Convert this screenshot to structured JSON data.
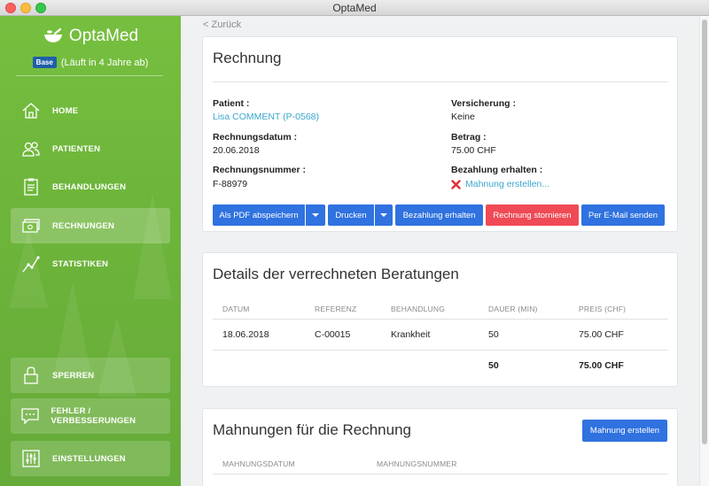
{
  "window": {
    "title": "OptaMed"
  },
  "sidebar": {
    "app_name": "OptaMed",
    "plan_badge": "Base",
    "plan_text": "(Läuft in 4 Jahre ab)",
    "nav": [
      {
        "label": "HOME",
        "icon": "home-icon"
      },
      {
        "label": "PATIENTEN",
        "icon": "patients-icon"
      },
      {
        "label": "BEHANDLUNGEN",
        "icon": "clipboard-icon"
      },
      {
        "label": "RECHNUNGEN",
        "icon": "invoice-icon",
        "active": true
      },
      {
        "label": "STATISTIKEN",
        "icon": "chart-line-icon"
      }
    ],
    "bottom": [
      {
        "label": "SPERREN",
        "icon": "lock-icon"
      },
      {
        "label": "FEHLER / VERBESSERUNGEN",
        "icon": "feedback-icon"
      },
      {
        "label": "EINSTELLUNGEN",
        "icon": "settings-sliders-icon"
      }
    ]
  },
  "back_link": "< Zurück",
  "invoice": {
    "title": "Rechnung",
    "patient_label": "Patient :",
    "patient_value": "Lisa COMMENT (P-0568)",
    "insurance_label": "Versicherung :",
    "insurance_value": "Keine",
    "date_label": "Rechnungsdatum :",
    "date_value": "20.06.2018",
    "amount_label": "Betrag :",
    "amount_value": "75.00 CHF",
    "number_label": "Rechnungsnummer :",
    "number_value": "F-88979",
    "payment_label": "Bezahlung erhalten :",
    "payment_value": "Mahnung erstellen...",
    "buttons": {
      "pdf": "Als PDF abspeichern",
      "print": "Drucken",
      "payment": "Bezahlung erhalten",
      "cancel": "Rechnung stornieren",
      "email": "Per E-Mail senden"
    }
  },
  "details": {
    "title": "Details der verrechneten Beratungen",
    "headers": [
      "DATUM",
      "REFERENZ",
      "BEHANDLUNG",
      "DAUER (MIN)",
      "PREIS (CHF)"
    ],
    "rows": [
      {
        "date": "18.06.2018",
        "reference": "C-00015",
        "treatment": "Krankheit",
        "duration": "50",
        "price": "75.00 CHF"
      }
    ],
    "total_duration": "50",
    "total_price": "75.00 CHF"
  },
  "reminders": {
    "title": "Mahnungen für die Rechnung",
    "create_button": "Mahnung erstellen",
    "headers": [
      "MAHNUNGSDATUM",
      "MAHNUNGSNUMMER"
    ]
  },
  "colors": {
    "sidebar_green": "#6db53a",
    "primary_blue": "#2f72e0",
    "danger_red": "#ef4a55",
    "link_teal": "#3aa7cf"
  }
}
